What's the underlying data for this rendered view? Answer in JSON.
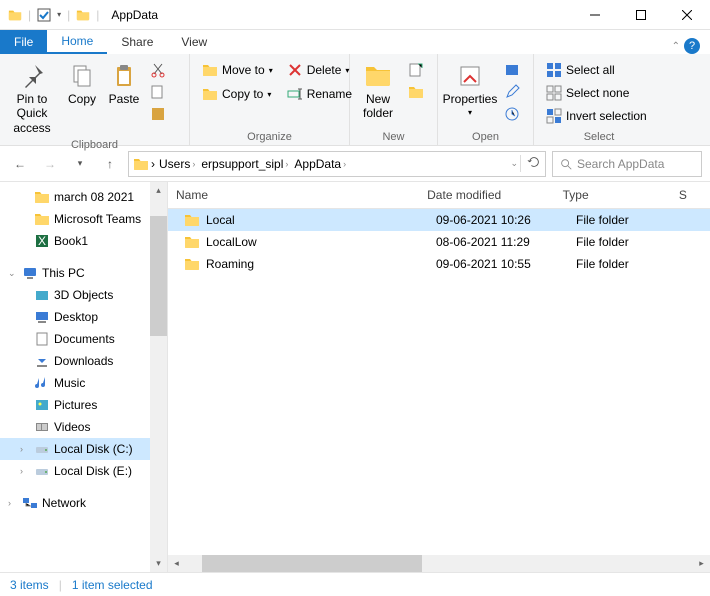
{
  "window": {
    "title": "AppData"
  },
  "tabs": {
    "file": "File",
    "home": "Home",
    "share": "Share",
    "view": "View"
  },
  "ribbon": {
    "clipboard": {
      "label": "Clipboard",
      "pin": "Pin to Quick access",
      "copy": "Copy",
      "paste": "Paste"
    },
    "organize": {
      "label": "Organize",
      "moveto": "Move to",
      "copyto": "Copy to",
      "delete": "Delete",
      "rename": "Rename"
    },
    "new": {
      "label": "New",
      "newfolder": "New folder"
    },
    "open": {
      "label": "Open",
      "properties": "Properties"
    },
    "select": {
      "label": "Select",
      "all": "Select all",
      "none": "Select none",
      "invert": "Invert selection"
    }
  },
  "breadcrumb": [
    "Users",
    "erpsupport_sipl",
    "AppData"
  ],
  "search": {
    "placeholder": "Search AppData"
  },
  "columns": {
    "name": "Name",
    "date": "Date modified",
    "type": "Type",
    "size": "S"
  },
  "files": [
    {
      "name": "Local",
      "date": "09-06-2021 10:26",
      "type": "File folder",
      "selected": true
    },
    {
      "name": "LocalLow",
      "date": "08-06-2021 11:29",
      "type": "File folder",
      "selected": false
    },
    {
      "name": "Roaming",
      "date": "09-06-2021 10:55",
      "type": "File folder",
      "selected": false
    }
  ],
  "sidebar": {
    "quick": [
      {
        "name": "march 08 2021",
        "icon": "folder"
      },
      {
        "name": "Microsoft Teams",
        "icon": "folder"
      },
      {
        "name": "Book1",
        "icon": "excel"
      }
    ],
    "thispc_label": "This PC",
    "thispc": [
      {
        "name": "3D Objects",
        "icon": "3d"
      },
      {
        "name": "Desktop",
        "icon": "desktop"
      },
      {
        "name": "Documents",
        "icon": "docs"
      },
      {
        "name": "Downloads",
        "icon": "down"
      },
      {
        "name": "Music",
        "icon": "music"
      },
      {
        "name": "Pictures",
        "icon": "pics"
      },
      {
        "name": "Videos",
        "icon": "video"
      },
      {
        "name": "Local Disk (C:)",
        "icon": "drive",
        "selected": true
      },
      {
        "name": "Local Disk (E:)",
        "icon": "drive"
      }
    ],
    "network_label": "Network"
  },
  "status": {
    "items": "3 items",
    "selected": "1 item selected"
  }
}
